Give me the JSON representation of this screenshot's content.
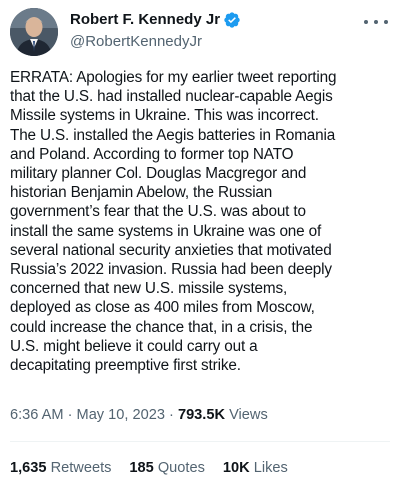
{
  "author": {
    "name": "Robert F. Kennedy Jr",
    "handle": "@RobertKennedyJr",
    "verified_color": "#1d9bf0"
  },
  "tweet": {
    "text": "ERRATA: Apologies for my earlier tweet reporting\nthat the U.S. had installed nuclear-capable Aegis\nMissile systems in Ukraine. This was incorrect.\nThe U.S. installed the Aegis batteries in Romania\nand Poland. According to former top NATO\nmilitary planner Col. Douglas Macgregor and\nhistorian Benjamin Abelow, the Russian\ngovernment’s fear that the U.S. was about to\ninstall the same systems in Ukraine was one of\nseveral national security anxieties that motivated\nRussia’s 2022 invasion. Russia had been deeply\nconcerned that new U.S. missile systems,\ndeployed as close as 400 miles from Moscow,\ncould increase the chance that, in a crisis, the\nU.S. might believe it could carry out a\ndecapitating preemptive first strike.",
    "time": "6:36 AM",
    "separator": " · ",
    "date": "May 10, 2023",
    "views_count": "793.5K",
    "views_label": " Views"
  },
  "stats": {
    "retweets_count": "1,635",
    "retweets_label": " Retweets",
    "quotes_count": "185",
    "quotes_label": " Quotes",
    "likes_count": "10K",
    "likes_label": " Likes"
  },
  "icons": {
    "more": "more-icon",
    "verified": "verified-badge-icon"
  }
}
